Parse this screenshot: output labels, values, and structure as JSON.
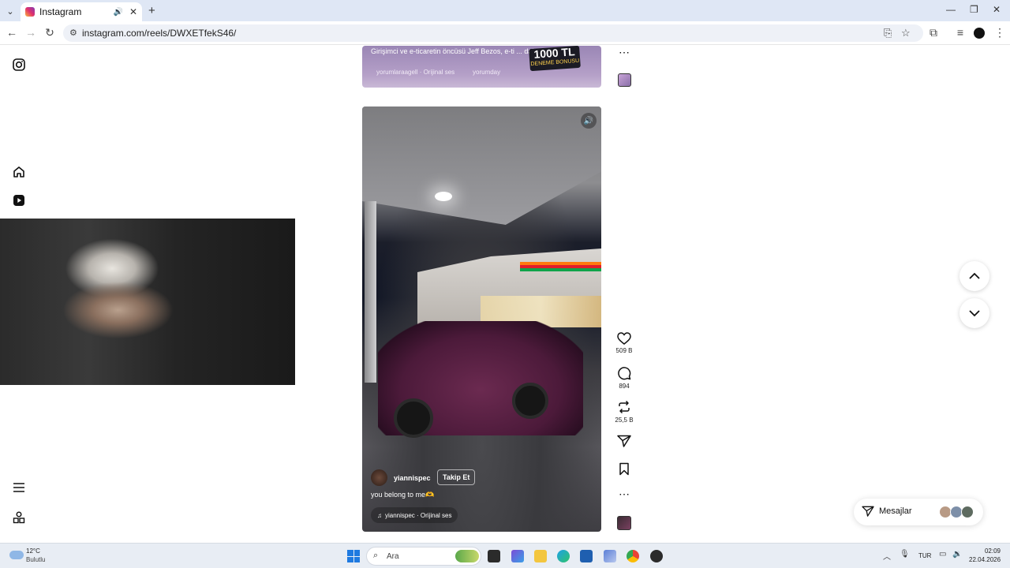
{
  "browser": {
    "tab_title": "Instagram",
    "new_tab_symbol": "+",
    "url": "instagram.com/reels/DWXETfekS46/"
  },
  "prev_reel": {
    "caption": "Girişimci ve e-ticaretin öncüsü Jeff Bezos, e-ti ... daha",
    "audio": "yorumlaraagell · Orijinal ses",
    "tagged_user": "yorumday",
    "badge_amount": "1000 TL",
    "badge_text": "DENEME BONUSU"
  },
  "reel": {
    "username": "yiannispec",
    "follow_label": "Takip Et",
    "caption": "you belong to me🫶",
    "audio": "yiannispec · Orijinal ses",
    "likes": "509 B",
    "comments": "894",
    "reposts": "25,5 B"
  },
  "messages": {
    "label": "Mesajlar"
  },
  "taskbar": {
    "temperature": "12°C",
    "weather": "Bulutlu",
    "search_placeholder": "Ara",
    "language": "TUR",
    "time": "02:09",
    "date": "22.04.2026"
  },
  "colors": {
    "accent": "#1f7ae0",
    "taskbar": "#e8edf4",
    "tabbar": "#dfe7f5"
  }
}
